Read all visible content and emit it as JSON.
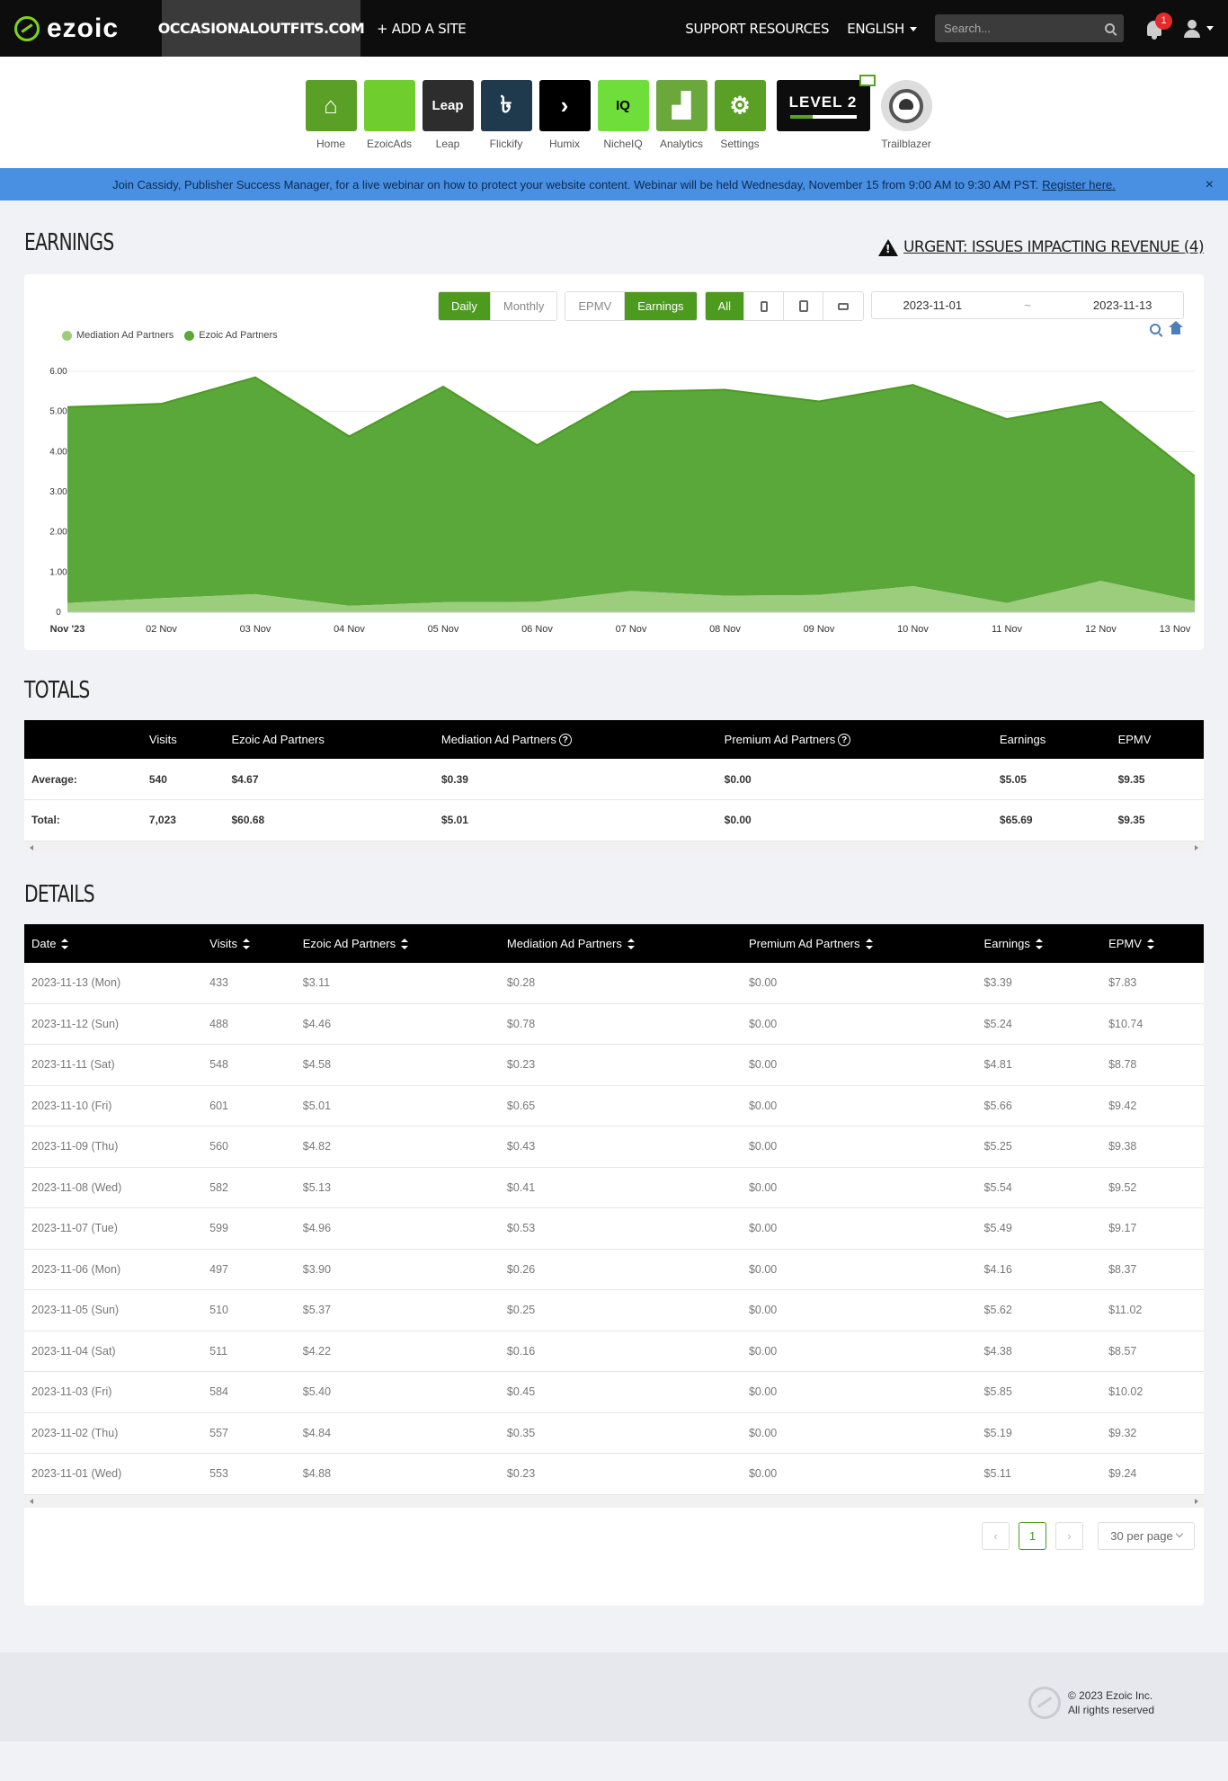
{
  "nav": {
    "logo": "ezoic",
    "site": "OCCASIONALOUTFITS.COM",
    "add_site": "+ ADD A SITE",
    "support": "SUPPORT RESOURCES",
    "language": "ENGLISH",
    "search_placeholder": "Search...",
    "notifications": "1"
  },
  "apps": [
    {
      "label": "Home",
      "color": "#5aa026",
      "tile": "⌂"
    },
    {
      "label": "EzoicAds",
      "color": "#6fce2e",
      "tile": ""
    },
    {
      "label": "Leap",
      "color": "#2d2d2d",
      "tile": "Leap"
    },
    {
      "label": "Flickify",
      "color": "#1e3a4c",
      "tile": "৳"
    },
    {
      "label": "Humix",
      "color": "#000000",
      "tile": "›"
    },
    {
      "label": "NicheIQ",
      "color": "#6fde3a",
      "tile": "IQ"
    },
    {
      "label": "Analytics",
      "color": "#6aa83c",
      "tile": "▟"
    },
    {
      "label": "Settings",
      "color": "#5aa026",
      "tile": "⚙"
    }
  ],
  "level": {
    "text": "LEVEL 2",
    "progress": 0.35
  },
  "trailblazer": "Trailblazer",
  "banner": {
    "text": "Join Cassidy, Publisher Success Manager, for a live webinar on how to protect your website content. Webinar will be held Wednesday, November 15 from 9:00 AM to 9:30 AM PST.",
    "link": "Register here.",
    "close": "×"
  },
  "earnings": {
    "title": "EARNINGS",
    "urgent": "URGENT: ISSUES IMPACTING REVENUE (4)",
    "controls": {
      "daily": "Daily",
      "monthly": "Monthly",
      "epmv": "EPMV",
      "earnings": "Earnings",
      "all": "All"
    },
    "date_from": "2023-11-01",
    "date_sep": "~",
    "date_to": "2023-11-13"
  },
  "chart_data": {
    "type": "area",
    "categories": [
      "Nov '23",
      "02 Nov",
      "03 Nov",
      "04 Nov",
      "05 Nov",
      "06 Nov",
      "07 Nov",
      "08 Nov",
      "09 Nov",
      "10 Nov",
      "11 Nov",
      "12 Nov",
      "13 Nov"
    ],
    "series": [
      {
        "name": "Mediation Ad Partners",
        "color": "#9ccd7c",
        "values": [
          0.23,
          0.35,
          0.45,
          0.16,
          0.25,
          0.26,
          0.53,
          0.41,
          0.43,
          0.65,
          0.23,
          0.78,
          0.28
        ]
      },
      {
        "name": "Ezoic Ad Partners",
        "color": "#5aa83a",
        "values": [
          4.88,
          4.84,
          5.4,
          4.22,
          5.37,
          3.9,
          4.96,
          5.13,
          4.82,
          5.01,
          4.58,
          4.46,
          3.11
        ]
      }
    ],
    "y_ticks": [
      "0",
      "1.00",
      "2.00",
      "3.00",
      "4.00",
      "5.00",
      "6.00"
    ],
    "ylim": [
      0,
      6
    ],
    "stacked": true,
    "grid": true,
    "legend": "top-left"
  },
  "totals": {
    "title": "TOTALS",
    "headers": [
      "",
      "Visits",
      "Ezoic Ad Partners",
      "Mediation Ad Partners",
      "Premium Ad Partners",
      "Earnings",
      "EPMV"
    ],
    "rows": [
      [
        "Average:",
        "540",
        "$4.67",
        "$0.39",
        "$0.00",
        "$5.05",
        "$9.35"
      ],
      [
        "Total:",
        "7,023",
        "$60.68",
        "$5.01",
        "$0.00",
        "$65.69",
        "$9.35"
      ]
    ]
  },
  "details": {
    "title": "DETAILS",
    "headers": [
      "Date",
      "Visits",
      "Ezoic Ad Partners",
      "Mediation Ad Partners",
      "Premium Ad Partners",
      "Earnings",
      "EPMV"
    ],
    "rows": [
      [
        "2023-11-13 (Mon)",
        "433",
        "$3.11",
        "$0.28",
        "$0.00",
        "$3.39",
        "$7.83"
      ],
      [
        "2023-11-12 (Sun)",
        "488",
        "$4.46",
        "$0.78",
        "$0.00",
        "$5.24",
        "$10.74"
      ],
      [
        "2023-11-11 (Sat)",
        "548",
        "$4.58",
        "$0.23",
        "$0.00",
        "$4.81",
        "$8.78"
      ],
      [
        "2023-11-10 (Fri)",
        "601",
        "$5.01",
        "$0.65",
        "$0.00",
        "$5.66",
        "$9.42"
      ],
      [
        "2023-11-09 (Thu)",
        "560",
        "$4.82",
        "$0.43",
        "$0.00",
        "$5.25",
        "$9.38"
      ],
      [
        "2023-11-08 (Wed)",
        "582",
        "$5.13",
        "$0.41",
        "$0.00",
        "$5.54",
        "$9.52"
      ],
      [
        "2023-11-07 (Tue)",
        "599",
        "$4.96",
        "$0.53",
        "$0.00",
        "$5.49",
        "$9.17"
      ],
      [
        "2023-11-06 (Mon)",
        "497",
        "$3.90",
        "$0.26",
        "$0.00",
        "$4.16",
        "$8.37"
      ],
      [
        "2023-11-05 (Sun)",
        "510",
        "$5.37",
        "$0.25",
        "$0.00",
        "$5.62",
        "$11.02"
      ],
      [
        "2023-11-04 (Sat)",
        "511",
        "$4.22",
        "$0.16",
        "$0.00",
        "$4.38",
        "$8.57"
      ],
      [
        "2023-11-03 (Fri)",
        "584",
        "$5.40",
        "$0.45",
        "$0.00",
        "$5.85",
        "$10.02"
      ],
      [
        "2023-11-02 (Thu)",
        "557",
        "$4.84",
        "$0.35",
        "$0.00",
        "$5.19",
        "$9.32"
      ],
      [
        "2023-11-01 (Wed)",
        "553",
        "$4.88",
        "$0.23",
        "$0.00",
        "$5.11",
        "$9.24"
      ]
    ],
    "pager": {
      "prev": "‹",
      "page": "1",
      "next": "›",
      "per_page": "30 per page"
    }
  },
  "footer": {
    "copyright": "© 2023 Ezoic Inc.",
    "rights": "All rights reserved"
  }
}
